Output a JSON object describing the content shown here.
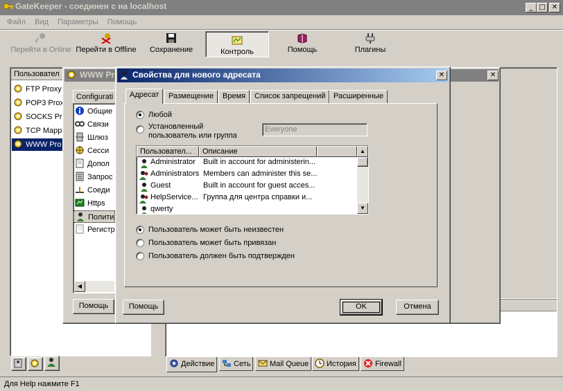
{
  "main_window": {
    "title": "GateKeeper - соединен с на localhost",
    "menu": [
      "Файл",
      "Вид",
      "Параметры",
      "Помощь"
    ],
    "toolbar": [
      {
        "label": "Перейти в Online",
        "icon": "key-icon",
        "disabled": true
      },
      {
        "label": "Перейти в Offline",
        "icon": "key-cross-icon"
      },
      {
        "label": "Сохранение",
        "icon": "floppy-disk-icon"
      },
      {
        "label": "Контроль",
        "icon": "control-panel-icon",
        "pressed": true
      },
      {
        "label": "Помощь",
        "icon": "help-book-icon"
      },
      {
        "label": "Плагины",
        "icon": "plug-icon"
      }
    ],
    "status": "Для Help нажмите F1"
  },
  "left_panel": {
    "header": "Пользовател",
    "items": [
      "FTP Proxy",
      "POP3 Prox",
      "SOCKS Pr",
      "TCP Mapp",
      "WWW Pro"
    ],
    "selected_index": 4
  },
  "bottom_tabs": [
    "Действие",
    "Сеть",
    "Mail Queue",
    "История",
    "Firewall"
  ],
  "www_dialog": {
    "title": "WWW Pro",
    "tab": "Configurati",
    "items": [
      "Общие",
      "Связи",
      "Шлюз",
      "Сесси",
      "Допол",
      "Запрос",
      "Соеди",
      "Https",
      "Полити",
      "Регистр"
    ],
    "selected_index": 8,
    "help_button": "Помощь"
  },
  "props_dialog": {
    "title": "Свойства для нового адресата",
    "tabs": [
      "Адресат",
      "Размещение",
      "Время",
      "Список запрещений",
      "Расширенные"
    ],
    "active_tab": 0,
    "radio_any": "Любой",
    "radio_specific": "Установленный пользователь или группа",
    "specific_value": "Everyone",
    "list_headers": [
      "Пользовател...",
      "Описание"
    ],
    "users": [
      {
        "name": "Administrator",
        "desc": "Built in account for administerin..."
      },
      {
        "name": "Administrators",
        "desc": "Members can administer this se..."
      },
      {
        "name": "Guest",
        "desc": "Built in account for guest acces..."
      },
      {
        "name": "HelpService...",
        "desc": "Группа для центра справки и..."
      },
      {
        "name": "qwerty",
        "desc": ""
      }
    ],
    "options": [
      "Пользователь может быть неизвестен",
      "Пользователь может быть привязан",
      "Пользователь должен быть подтвержден"
    ],
    "selected_option": 0,
    "help_button": "Помощь",
    "ok_button": "OK",
    "cancel_button": "Отмена"
  }
}
